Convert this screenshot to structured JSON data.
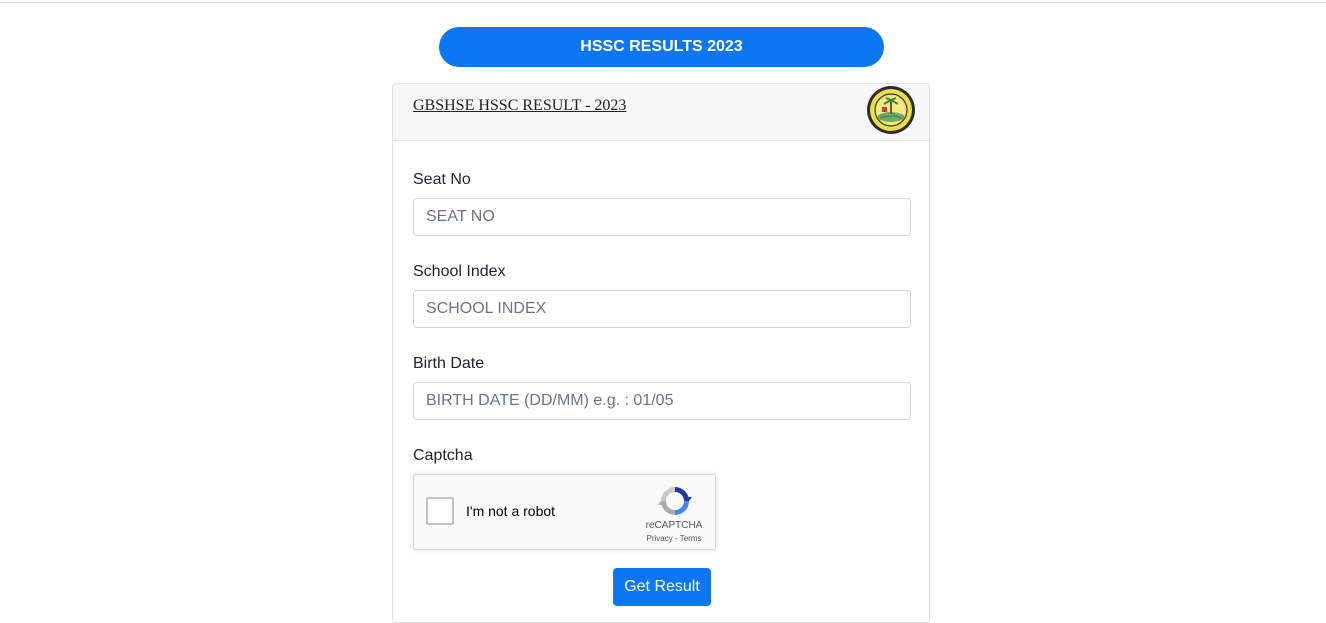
{
  "banner": {
    "label": "HSSC RESULTS 2023"
  },
  "card": {
    "title": "GBSHSE HSSC RESULT - 2023",
    "logo_icon": "gbshse-seal"
  },
  "form": {
    "seat": {
      "label": "Seat No",
      "placeholder": "SEAT NO",
      "value": ""
    },
    "school": {
      "label": "School Index",
      "placeholder": "SCHOOL INDEX",
      "value": ""
    },
    "birth": {
      "label": "Birth Date",
      "placeholder": "BIRTH DATE (DD/MM) e.g. : 01/05",
      "value": ""
    },
    "captcha": {
      "label": "Captcha",
      "checkbox_label": "I'm not a robot",
      "brand": "reCAPTCHA",
      "privacy": "Privacy",
      "separator": " - ",
      "terms": "Terms",
      "checked": false
    },
    "submit_label": "Get Result"
  },
  "colors": {
    "accent": "#0d77f3",
    "header_bg": "#f7f7f7",
    "border": "#dfdfdf"
  }
}
